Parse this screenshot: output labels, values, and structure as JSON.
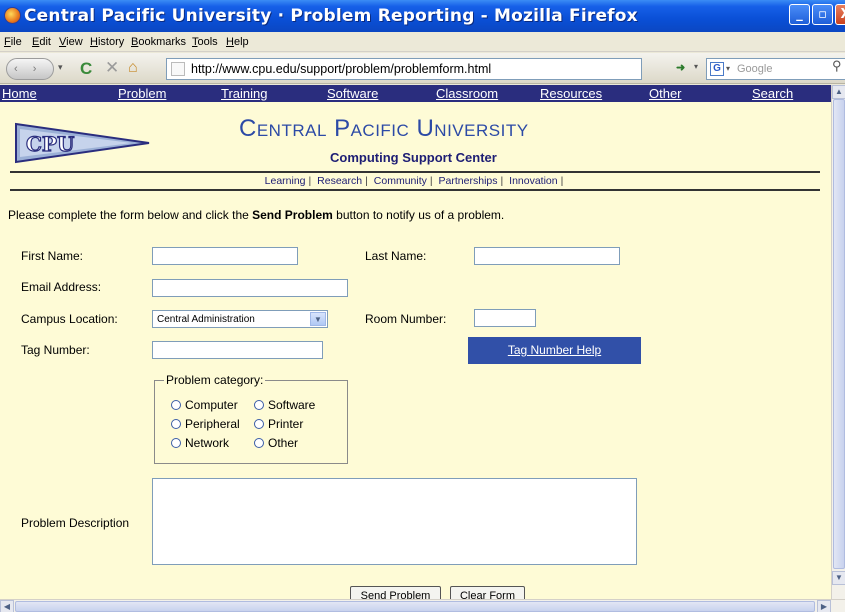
{
  "window": {
    "title": "Central Pacific University · Problem Reporting - Mozilla Firefox",
    "minimize": "_",
    "maximize": "▫",
    "close": "X"
  },
  "menu": [
    "File",
    "Edit",
    "View",
    "History",
    "Bookmarks",
    "Tools",
    "Help"
  ],
  "toolbar": {
    "url": "http://www.cpu.edu/support/problem/problemform.html",
    "search_placeholder": "Google",
    "back_forward": "‹ ›",
    "reload_icon": "C",
    "stop_icon": "✕",
    "home_icon": "⌂",
    "go_icon": "➜",
    "dropdown": "▾",
    "search_engine_icon": "G",
    "search_icon": "⚲"
  },
  "site_nav": [
    "Home",
    "Problem",
    "Training",
    "Software",
    "Classroom",
    "Resources",
    "Other",
    "Search"
  ],
  "header": {
    "logo_text": "CPU",
    "university": "Central Pacific University",
    "department": "Computing Support Center",
    "sublinks": [
      "Learning",
      "Research",
      "Community",
      "Partnerships",
      "Innovation"
    ]
  },
  "intro": {
    "before": "Please complete the form below and click the ",
    "bold": "Send Problem",
    "after": " button to notify us of a problem."
  },
  "form": {
    "first_name_label": "First Name:",
    "last_name_label": "Last Name:",
    "email_label": "Email Address:",
    "campus_label": "Campus Location:",
    "campus_value": "Central Administration",
    "room_label": "Room Number:",
    "tag_label": "Tag Number:",
    "tag_help": "Tag Number Help",
    "category_legend": "Problem category:",
    "categories": [
      "Computer",
      "Software",
      "Peripheral",
      "Printer",
      "Network",
      "Other"
    ],
    "description_label": "Problem Description",
    "send_button": "Send Problem",
    "clear_button": "Clear Form"
  },
  "colors": {
    "page_background": "#fefbd6",
    "nav_background": "#2a2d7e",
    "title_color": "#2c4aa6",
    "button_blue": "#3150a8"
  }
}
